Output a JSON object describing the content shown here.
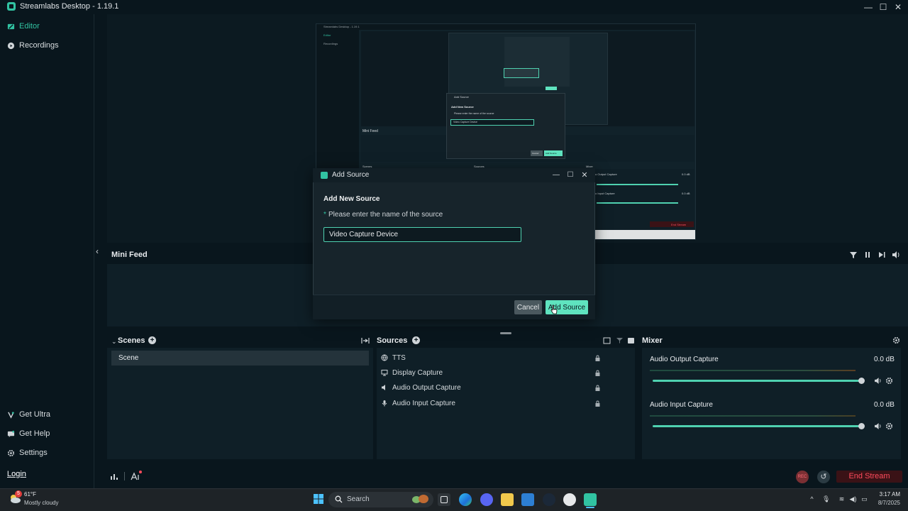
{
  "window": {
    "title": "Streamlabs Desktop - 1.19.1"
  },
  "sidebar": {
    "items": [
      {
        "label": "Editor",
        "icon": "editor-icon",
        "active": true
      },
      {
        "label": "Recordings",
        "icon": "recordings-icon",
        "active": false
      }
    ],
    "bottom_items": [
      {
        "label": "Get Ultra",
        "icon": "ultra-icon"
      },
      {
        "label": "Get Help",
        "icon": "help-icon"
      },
      {
        "label": "Settings",
        "icon": "gear-icon"
      }
    ],
    "login": "Login"
  },
  "mini_feed": {
    "title": "Mini Feed"
  },
  "scenes": {
    "title": "Scenes",
    "items": [
      "Scene"
    ]
  },
  "sources": {
    "title": "Sources",
    "items": [
      {
        "label": "TTS",
        "icon": "globe-icon"
      },
      {
        "label": "Display Capture",
        "icon": "monitor-icon"
      },
      {
        "label": "Audio Output Capture",
        "icon": "speaker-icon"
      },
      {
        "label": "Audio Input Capture",
        "icon": "microphone-icon"
      }
    ]
  },
  "mixer": {
    "title": "Mixer",
    "channels": [
      {
        "name": "Audio Output Capture",
        "db": "0.0 dB",
        "volume": 1.0
      },
      {
        "name": "Audio Input Capture",
        "db": "0.0 dB",
        "volume": 1.0
      }
    ]
  },
  "footer": {
    "end_stream": "End Stream",
    "rec_label": "REC"
  },
  "dialog": {
    "title": "Add Source",
    "heading": "Add New Source",
    "prompt": "Please enter the name of the source",
    "input_value": "Video Capture Device",
    "cancel": "Cancel",
    "submit": "Add Source"
  },
  "nested_preview": {
    "title": "Streamlabs Desktop - 1.19.1",
    "nav": [
      "Editor",
      "Recordings"
    ],
    "mini_feed": "Mini Feed",
    "scenes": "Scenes",
    "sources": "Sources",
    "mixer": "Mixer",
    "dialog_title": "Add Source",
    "dialog_heading": "Add New Source",
    "dialog_prompt": "Please enter the name of the source",
    "dialog_input": "Video Capture Device",
    "dialog_cancel": "Cancel",
    "dialog_submit": "Add Source",
    "mixer_rows": [
      {
        "name": "Audio Output Capture",
        "db": "0.0 dB"
      },
      {
        "name": "Audio Input Capture",
        "db": "0.0 dB"
      }
    ],
    "end_stream": "End Stream"
  },
  "taskbar": {
    "weather_temp": "61°F",
    "weather_desc": "Mostly cloudy",
    "weather_badge": "5",
    "search_placeholder": "Search",
    "time": "3:17 AM",
    "date": "8/7/2025"
  },
  "colors": {
    "accent": "#31c3a2",
    "danger": "#ff4b5c",
    "bg": "#09161d",
    "panel": "#0f1f27"
  }
}
